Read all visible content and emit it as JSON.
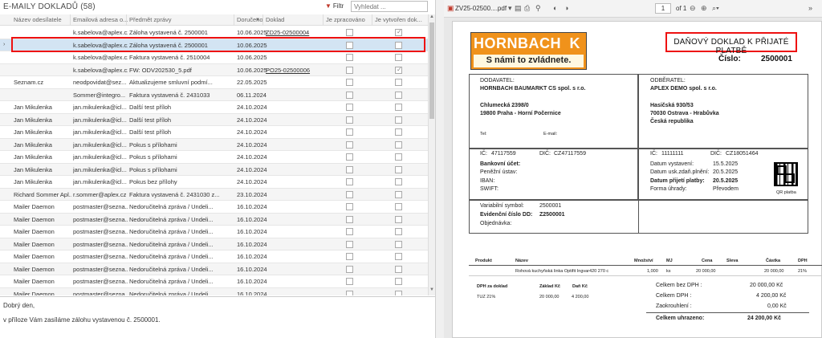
{
  "left": {
    "title": "E-MAILY DOKLADŮ (58)",
    "filter_label": "Filtr",
    "search_placeholder": "Vyhledat ...",
    "columns": [
      "Název odesílatele",
      "Emailová adresa o...",
      "Předmět zprávy",
      "Doručeno",
      "Doklad",
      "Je zpracováno",
      "Je vytvořen dok..."
    ],
    "rows": [
      {
        "sender": "",
        "email": "k.sabelova@aplex.cz",
        "subject": "Záloha vystavená č. 2500001",
        "date": "10.06.2025",
        "doc": "ZD25-02500004",
        "done": false,
        "created": true
      },
      {
        "sender": "",
        "email": "k.sabelova@aplex.cz",
        "subject": "Záloha vystavená č. 2500001",
        "date": "10.06.2025",
        "doc": "",
        "done": false,
        "created": false
      },
      {
        "sender": "",
        "email": "k.sabelova@aplex.cz",
        "subject": "Faktura vystavená č. 2510004",
        "date": "10.06.2025",
        "doc": "",
        "done": false,
        "created": false
      },
      {
        "sender": "",
        "email": "k.sabelova@aplex.cz",
        "subject": "FW: ODV202530_5.pdf",
        "date": "10.06.2025",
        "doc": "PO25-02500006",
        "done": false,
        "created": true
      },
      {
        "sender": "Seznam.cz",
        "email": "neodpovidat@sez...",
        "subject": "Aktualizujeme smluvní podmí...",
        "date": "22.05.2025",
        "doc": "",
        "done": false,
        "created": false
      },
      {
        "sender": "",
        "email": "Sommer@integro...",
        "subject": "Faktura vystavená č. 2431033",
        "date": "06.11.2024",
        "doc": "",
        "done": false,
        "created": false
      },
      {
        "sender": "Jan Mikulenka",
        "email": "jan.mikulenka@icl...",
        "subject": "Další test příloh",
        "date": "24.10.2024",
        "doc": "",
        "done": false,
        "created": false
      },
      {
        "sender": "Jan Mikulenka",
        "email": "jan.mikulenka@icl...",
        "subject": "Další test příloh",
        "date": "24.10.2024",
        "doc": "",
        "done": false,
        "created": false
      },
      {
        "sender": "Jan Mikulenka",
        "email": "jan.mikulenka@icl...",
        "subject": "Další test příloh",
        "date": "24.10.2024",
        "doc": "",
        "done": false,
        "created": false
      },
      {
        "sender": "Jan Mikulenka",
        "email": "jan.mikulenka@icl...",
        "subject": "Pokus s přílohami",
        "date": "24.10.2024",
        "doc": "",
        "done": false,
        "created": false
      },
      {
        "sender": "Jan Mikulenka",
        "email": "jan.mikulenka@icl...",
        "subject": "Pokus s přílohami",
        "date": "24.10.2024",
        "doc": "",
        "done": false,
        "created": false
      },
      {
        "sender": "Jan Mikulenka",
        "email": "jan.mikulenka@icl...",
        "subject": "Pokus s přílohami",
        "date": "24.10.2024",
        "doc": "",
        "done": false,
        "created": false
      },
      {
        "sender": "Jan Mikulenka",
        "email": "jan.mikulenka@icl...",
        "subject": "Pokus bez přílohy",
        "date": "24.10.2024",
        "doc": "",
        "done": false,
        "created": false
      },
      {
        "sender": "Richard Sommer Apl...",
        "email": "r.sommer@aplex.cz",
        "subject": "Faktura vystavená č. 2431030 z...",
        "date": "23.10.2024",
        "doc": "",
        "done": false,
        "created": false
      },
      {
        "sender": "Mailer Daemon",
        "email": "postmaster@sezna...",
        "subject": "Nedoručitelná zpráva / Undeli...",
        "date": "16.10.2024",
        "doc": "",
        "done": false,
        "created": false
      },
      {
        "sender": "Mailer Daemon",
        "email": "postmaster@sezna...",
        "subject": "Nedoručitelná zpráva / Undeli...",
        "date": "16.10.2024",
        "doc": "",
        "done": false,
        "created": false
      },
      {
        "sender": "Mailer Daemon",
        "email": "postmaster@sezna...",
        "subject": "Nedoručitelná zpráva / Undeli...",
        "date": "16.10.2024",
        "doc": "",
        "done": false,
        "created": false
      },
      {
        "sender": "Mailer Daemon",
        "email": "postmaster@sezna...",
        "subject": "Nedoručitelná zpráva / Undeli...",
        "date": "16.10.2024",
        "doc": "",
        "done": false,
        "created": false
      },
      {
        "sender": "Mailer Daemon",
        "email": "postmaster@sezna...",
        "subject": "Nedoručitelná zpráva / Undeli...",
        "date": "16.10.2024",
        "doc": "",
        "done": false,
        "created": false
      },
      {
        "sender": "Mailer Daemon",
        "email": "postmaster@sezna...",
        "subject": "Nedoručitelná zpráva / Undeli...",
        "date": "16.10.2024",
        "doc": "",
        "done": false,
        "created": false
      },
      {
        "sender": "Mailer Daemon",
        "email": "postmaster@sezna...",
        "subject": "Nedoručitelná zpráva / Undeli...",
        "date": "16.10.2024",
        "doc": "",
        "done": false,
        "created": false
      },
      {
        "sender": "Mailer Daemon",
        "email": "postmaster@sezna...",
        "subject": "Nedoručitelná zpráva / Undeli...",
        "date": "16.10.2024",
        "doc": "",
        "done": false,
        "created": false
      }
    ],
    "preview_line1": "Dobrý den,",
    "preview_line2": "v příloze Vám zasíláme zálohu vystavenou č. 2500001."
  },
  "pdf": {
    "filename": "ZV25-02500....pdf",
    "page_value": "1",
    "page_of": "of 1",
    "logo_top": "HORNBACH",
    "logo_x": "K",
    "logo_bottom": "S námi to zvládnete.",
    "doc_title": "DAŇOVÝ DOKLAD K PŘIJATÉ PLATBĚ",
    "cislo_label": "Číslo:",
    "cislo_value": "2500001",
    "dodavatel_label": "DODAVATEL:",
    "dodavatel_name": "HORNBACH BAUMARKT CS spol. s r.o.",
    "dodavatel_street": "Chlumecká 2398/0",
    "dodavatel_city": "19800    Praha - Horní Počernice",
    "tel_label": "Tel:",
    "email_label": "E-mail:",
    "odberatel_label": "ODBĚRATEL:",
    "odberatel_name": "APLEX DEMO spol. s r.o.",
    "odberatel_street": "Hasičská 930/53",
    "odberatel_city": "70030    Ostrava - Hrabůvka",
    "odberatel_country": "Česká republika",
    "ic_label_l": "IČ:",
    "ic_value_l": "47117559",
    "dic_label_l": "DIČ:",
    "dic_value_l": "CZ47117559",
    "bank_label": "Bankovní účet:",
    "penezni_label": "Peněžní ústav:",
    "iban_label": "IBAN:",
    "swift_label": "SWIFT:",
    "ic_label_r": "IČ:",
    "ic_value_r": "11111111",
    "dic_label_r": "DIČ:",
    "dic_value_r": "CZ18051464",
    "datum_vyst_label": "Datum vystavení:",
    "datum_vyst_value": "15.5.2025",
    "datum_usk_label": "Datum usk.zdaň.plnění:",
    "datum_usk_value": "20.5.2025",
    "datum_prij_label": "Datum přijetí platby:",
    "datum_prij_value": "20.5.2025",
    "forma_label": "Forma úhrady:",
    "forma_value": "Převodem",
    "qr_label": "QR platba",
    "vs_label": "Variabilní symbol:",
    "vs_value": "2500001",
    "evid_label": "Evidenční číslo DD:",
    "evid_value": "Z2500001",
    "objednavka_label": "Objednávka:",
    "items_headers": [
      "Produkt",
      "Název",
      "Množství",
      "MJ",
      "Cena",
      "Sleva",
      "Částka",
      "DPH"
    ],
    "item_name": "Rohová kuchyňská linka Optifit Ingvar420 270 c",
    "item_qty": "1,000",
    "item_mj": "ks",
    "item_price": "20 000,00",
    "item_amount": "20 000,00",
    "item_vat": "21%",
    "vat_headers": [
      "DPH za doklad",
      "Základ Kč",
      "Daň Kč"
    ],
    "vat_row": [
      "TUZ 21%",
      "20 000,00",
      "4 200,00"
    ],
    "sum_bez_label": "Celkem bez DPH :",
    "sum_bez_value": "20 000,00 Kč",
    "sum_dph_label": "Celkem DPH :",
    "sum_dph_value": "4 200,00 Kč",
    "zaokr_label": "Zaokrouhlení :",
    "zaokr_value": "0,00 Kč",
    "total_label": "Celkem uhrazeno:",
    "total_value": "24 200,00 Kč"
  }
}
